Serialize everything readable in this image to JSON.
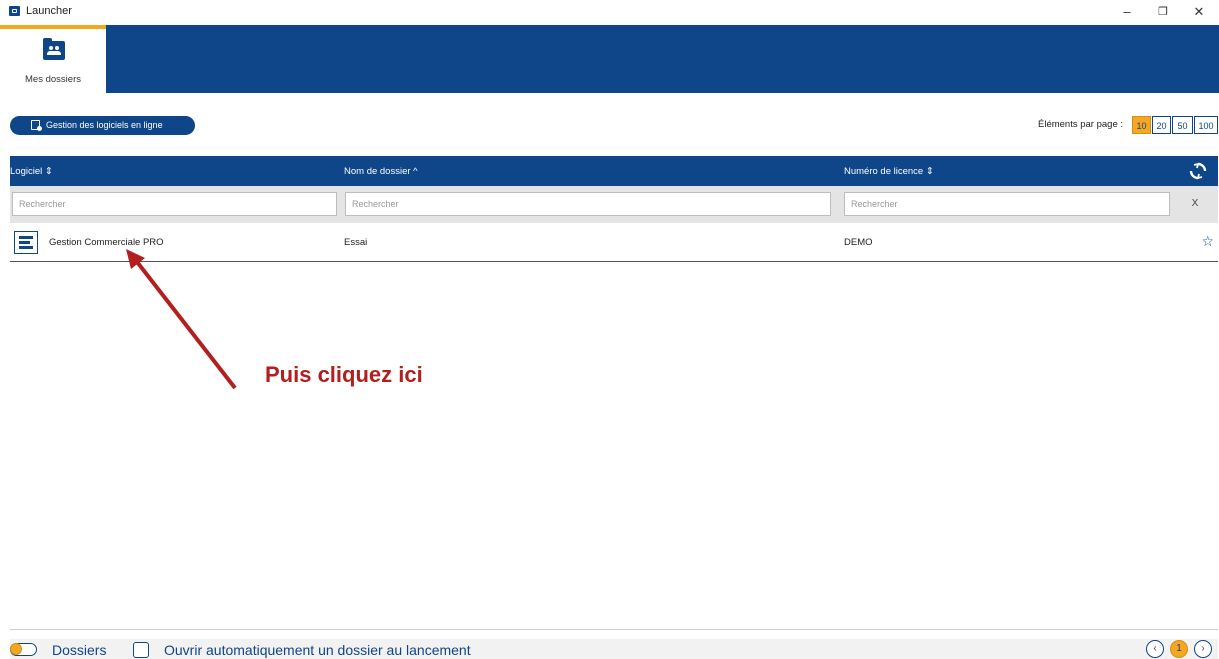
{
  "window": {
    "title": "Launcher",
    "minimize": "–",
    "restore": "❐",
    "close": "✕"
  },
  "nav": {
    "tab_label": "Mes dossiers",
    "tab_icon": "folder-users-icon"
  },
  "toolbar": {
    "online_button": "Gestion des logiciels en ligne",
    "per_page_label": "Éléments par page :",
    "per_page_options": [
      "10",
      "20",
      "50",
      "100"
    ],
    "per_page_selected": "10"
  },
  "table": {
    "columns": [
      {
        "label": "Logiciel",
        "sort": "⇕"
      },
      {
        "label": "Nom de dossier",
        "sort": "^"
      },
      {
        "label": "Numéro de licence",
        "sort": "⇕"
      }
    ],
    "filters": {
      "placeholder": "Rechercher",
      "clear": "X"
    },
    "rows": [
      {
        "software": "Gestion Commerciale PRO",
        "folder": "Essai",
        "license": "DEMO",
        "favorite": "☆"
      }
    ]
  },
  "annotation": {
    "text": "Puis cliquez ici",
    "color": "#b31e1e"
  },
  "footer": {
    "toggle_label": "Dossiers",
    "checkbox_label": "Ouvrir automatiquement un dossier au lancement",
    "prev": "‹",
    "current_page": "1",
    "next": "›"
  },
  "colors": {
    "primary": "#0f4589",
    "accent": "#f5a623"
  }
}
